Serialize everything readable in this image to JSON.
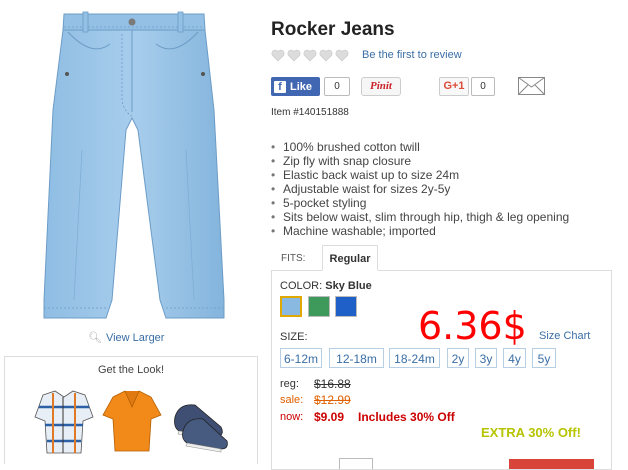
{
  "product": {
    "title": "Rocker Jeans",
    "review_link": "Be the first to review",
    "item_number": "Item #140151888",
    "features": [
      "100% brushed cotton twill",
      "Zip fly with snap closure",
      "Elastic back waist up to size 24m",
      "Adjustable waist for sizes 2y-5y",
      "5-pocket styling",
      "Sits below waist, slim through hip, thigh & leg opening",
      "Machine washable; imported"
    ],
    "rating_hearts": 5
  },
  "image": {
    "view_larger": "View Larger"
  },
  "get_the_look": {
    "title": "Get the Look!"
  },
  "social": {
    "fb_like": "Like",
    "fb_count": "0",
    "pinit": "Pinit",
    "gplus": "G+1",
    "gplus_count": "0"
  },
  "options": {
    "fits_label": "FITS:",
    "fit_tab": "Regular",
    "color_label": "COLOR:",
    "color_name": "Sky Blue",
    "swatches": [
      "#89b8e0",
      "#3e9a5a",
      "#1e5fc8"
    ],
    "size_label": "SIZE:",
    "size_chart": "Size Chart",
    "sizes": [
      "6-12m",
      "12-18m",
      "18-24m",
      "2y",
      "3y",
      "4y",
      "5y"
    ]
  },
  "pricing": {
    "reg_label": "reg:",
    "reg_value": "$16.88",
    "sale_label": "sale:",
    "sale_value": "$12.99",
    "now_label": "now:",
    "now_value": "$9.09",
    "includes": "Includes 30% Off",
    "extra_off": "EXTRA 30% Off!"
  },
  "overlay_price": "6.36$",
  "colors": {
    "link": "#3a6ea5",
    "price_red": "#cc0000",
    "sale_orange": "#e06000",
    "extra_green": "#b7c400",
    "overlay_red": "#ff0000"
  }
}
